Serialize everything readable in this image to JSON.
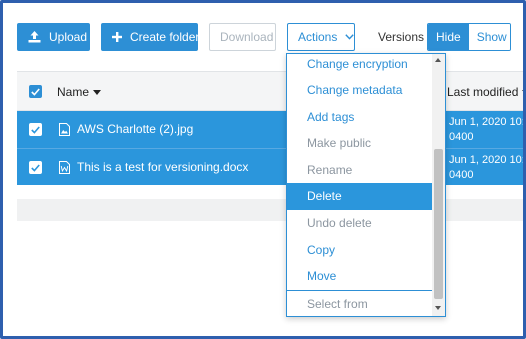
{
  "toolbar": {
    "upload_label": "Upload",
    "create_folder_label": "Create folder",
    "download_label": "Download",
    "actions_label": "Actions",
    "versions_label": "Versions",
    "hide_label": "Hide",
    "show_label": "Show"
  },
  "table": {
    "header_name": "Name",
    "header_modified": "Last modified",
    "rows": [
      {
        "name": "AWS Charlotte (2).jpg",
        "modified_line1": "Jun 1, 2020 10:",
        "modified_line2": "0400",
        "checked": true,
        "icon": "image-file-icon"
      },
      {
        "name": "This is a test for versioning.docx",
        "modified_line1": "Jun 1, 2020 10:",
        "modified_line2": "0400",
        "checked": true,
        "icon": "document-file-icon"
      }
    ]
  },
  "actions_menu": {
    "items": [
      {
        "label": "Change encryption",
        "state": "enabled"
      },
      {
        "label": "Change metadata",
        "state": "enabled"
      },
      {
        "label": "Add tags",
        "state": "enabled"
      },
      {
        "label": "Make public",
        "state": "disabled"
      },
      {
        "label": "Rename",
        "state": "disabled"
      },
      {
        "label": "Delete",
        "state": "highlighted"
      },
      {
        "label": "Undo delete",
        "state": "disabled"
      },
      {
        "label": "Copy",
        "state": "enabled"
      },
      {
        "label": "Move",
        "state": "enabled"
      },
      {
        "label": "Select from",
        "state": "disabled"
      }
    ]
  },
  "colors": {
    "accent": "#2d8fd5",
    "selected_row": "#2b96dc",
    "frame_border": "#2e5fae"
  }
}
